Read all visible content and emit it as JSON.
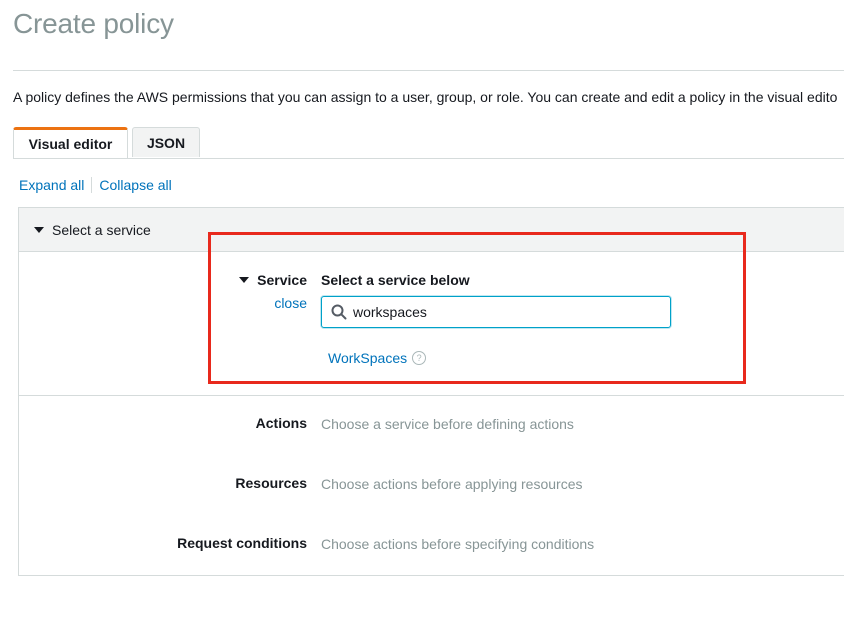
{
  "page": {
    "title": "Create policy",
    "description": "A policy defines the AWS permissions that you can assign to a user, group, or role. You can create and edit a policy in the visual edito"
  },
  "tabs": [
    {
      "label": "Visual editor",
      "active": true
    },
    {
      "label": "JSON",
      "active": false
    }
  ],
  "links": {
    "expand_all": "Expand all",
    "collapse_all": "Collapse all"
  },
  "section": {
    "header": "Select a service",
    "service_label": "Service",
    "close_label": "close",
    "select_heading": "Select a service below",
    "search": {
      "value": "workspaces",
      "icon": "search-icon"
    },
    "result": {
      "label": "WorkSpaces",
      "icon": "help-icon"
    }
  },
  "fields": [
    {
      "label": "Actions",
      "hint": "Choose a service before defining actions"
    },
    {
      "label": "Resources",
      "hint": "Choose actions before applying resources"
    },
    {
      "label": "Request conditions",
      "hint": "Choose actions before specifying conditions"
    }
  ],
  "colors": {
    "accent_tab": "#ec7211",
    "link": "#0073bb",
    "focus": "#00a1c9",
    "highlight": "#e8291c"
  }
}
